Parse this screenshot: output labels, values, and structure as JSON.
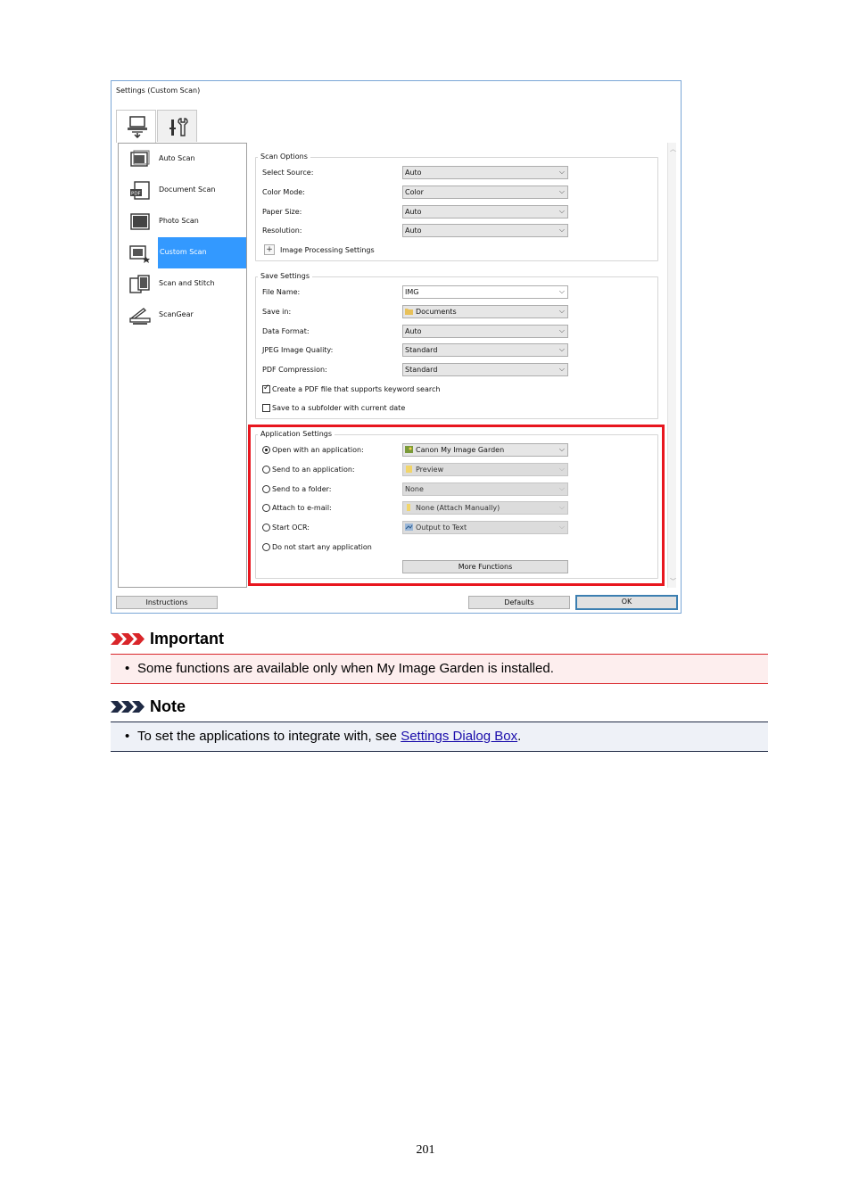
{
  "dialog": {
    "title": "Settings (Custom Scan)",
    "tabs": [
      {
        "name": "scan-from-computer-tab",
        "icon": "computer-scanner-icon",
        "active": true
      },
      {
        "name": "general-settings-tab",
        "icon": "tools-icon",
        "active": false
      }
    ],
    "scan_modes": [
      {
        "label": "Auto Scan",
        "icon": "auto-scan-icon",
        "selected": false
      },
      {
        "label": "Document Scan",
        "icon": "document-scan-icon",
        "selected": false
      },
      {
        "label": "Photo Scan",
        "icon": "photo-scan-icon",
        "selected": false
      },
      {
        "label": "Custom Scan",
        "icon": "custom-scan-icon",
        "selected": true
      },
      {
        "label": "Scan and Stitch",
        "icon": "scan-and-stitch-icon",
        "selected": false
      },
      {
        "label": "ScanGear",
        "icon": "scangear-icon",
        "selected": false
      }
    ],
    "scan_options": {
      "title": "Scan Options",
      "fields": [
        {
          "label": "Select Source:",
          "value": "Auto"
        },
        {
          "label": "Color Mode:",
          "value": "Color"
        },
        {
          "label": "Paper Size:",
          "value": "Auto"
        },
        {
          "label": "Resolution:",
          "value": "Auto"
        }
      ],
      "expander_label": "Image Processing Settings",
      "expander_symbol": "+"
    },
    "save_settings": {
      "title": "Save Settings",
      "fields": [
        {
          "label": "File Name:",
          "value": "IMG"
        },
        {
          "label": "Save in:",
          "value": "Documents"
        },
        {
          "label": "Data Format:",
          "value": "Auto"
        },
        {
          "label": "JPEG Image Quality:",
          "value": "Standard"
        },
        {
          "label": "PDF Compression:",
          "value": "Standard"
        }
      ],
      "checkboxes": [
        {
          "label": "Create a PDF file that supports keyword search",
          "checked": true
        },
        {
          "label": "Save to a subfolder with current date",
          "checked": false
        }
      ]
    },
    "application_settings": {
      "title": "Application Settings",
      "options": [
        {
          "label": "Open with an application:",
          "value": "Canon My Image Garden",
          "selected": true
        },
        {
          "label": "Send to an application:",
          "value": "Preview",
          "selected": false
        },
        {
          "label": "Send to a folder:",
          "value": "None",
          "selected": false
        },
        {
          "label": "Attach to e-mail:",
          "value": "None (Attach Manually)",
          "selected": false
        },
        {
          "label": "Start OCR:",
          "value": "Output to Text",
          "selected": false
        },
        {
          "label": "Do not start any application",
          "value": null,
          "selected": false
        }
      ],
      "more_functions_label": "More Functions"
    },
    "buttons": {
      "instructions": "Instructions",
      "defaults": "Defaults",
      "ok": "OK"
    },
    "highlight_color": "#e8161e"
  },
  "important": {
    "title": "Important",
    "bullet": "•",
    "text": "Some functions are available only when My Image Garden is installed.",
    "color": "#d9262a"
  },
  "note": {
    "title": "Note",
    "bullet": "•",
    "text_before": "To set the applications to integrate with, see ",
    "link_text": "Settings Dialog Box",
    "text_after": ".",
    "color": "#1f2a44"
  },
  "page_number": "201"
}
